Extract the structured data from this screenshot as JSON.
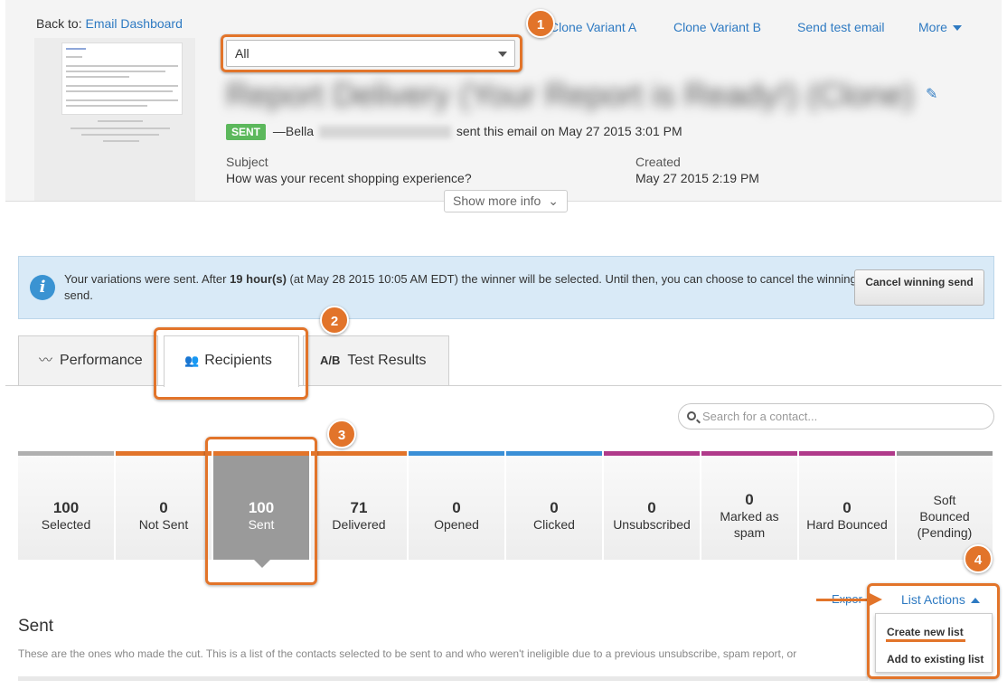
{
  "header": {
    "back_prefix": "Back to:",
    "back_link": "Email Dashboard",
    "actions": [
      "Clone Variant A",
      "Clone Variant B",
      "Send test email",
      "More"
    ],
    "filter_value": "All",
    "email_title": "Report Delivery (Your Report is Ready!) (Clone)",
    "status_badge": "SENT",
    "sender_prefix": "—Bella",
    "sent_text": "sent this email on May 27 2015 3:01 PM",
    "subject_label": "Subject",
    "subject_value": "How was your recent shopping experience?",
    "created_label": "Created",
    "created_value": "May 27 2015 2:19 PM",
    "show_more": "Show more info"
  },
  "markers": [
    "1",
    "2",
    "3",
    "4"
  ],
  "banner": {
    "text_before": "Your variations were sent. After ",
    "text_bold": "19 hour(s)",
    "text_after": " (at May 28 2015 10:05 AM EDT) the winner will be selected. Until then, you can choose to cancel the winning send.",
    "cancel_button": "Cancel winning send"
  },
  "tabs": [
    {
      "label": "Performance",
      "icon": "pulse-icon"
    },
    {
      "label": "Recipients",
      "icon": "people-icon"
    },
    {
      "label": "Test Results",
      "icon": "ab-icon",
      "icon_text": "A/B"
    }
  ],
  "search": {
    "placeholder": "Search for a contact..."
  },
  "stats": [
    {
      "value": "100",
      "label": "Selected",
      "color": "#b0b0b0"
    },
    {
      "value": "0",
      "label": "Not Sent",
      "color": "#e2742a"
    },
    {
      "value": "100",
      "label": "Sent",
      "color": "#e2742a"
    },
    {
      "value": "71",
      "label": "Delivered",
      "color": "#e2742a"
    },
    {
      "value": "0",
      "label": "Opened",
      "color": "#3a8fd6"
    },
    {
      "value": "0",
      "label": "Clicked",
      "color": "#3a8fd6"
    },
    {
      "value": "0",
      "label": "Unsubscribed",
      "color": "#b03a8a"
    },
    {
      "value": "0",
      "label": "Marked as spam",
      "color": "#b03a8a"
    },
    {
      "value": "0",
      "label": "Hard Bounced",
      "color": "#b03a8a"
    },
    {
      "value": "",
      "label": "Soft Bounced (Pending)",
      "color": "#999999"
    }
  ],
  "section": {
    "title": "Sent",
    "description": "These are the ones who made the cut. This is a list of the contacts selected to be sent to and who weren't ineligible due to a previous unsubscribe, spam report, or"
  },
  "list_actions": {
    "export": "Expor",
    "label": "List Actions",
    "items": [
      "Create new list",
      "Add to existing list"
    ]
  }
}
